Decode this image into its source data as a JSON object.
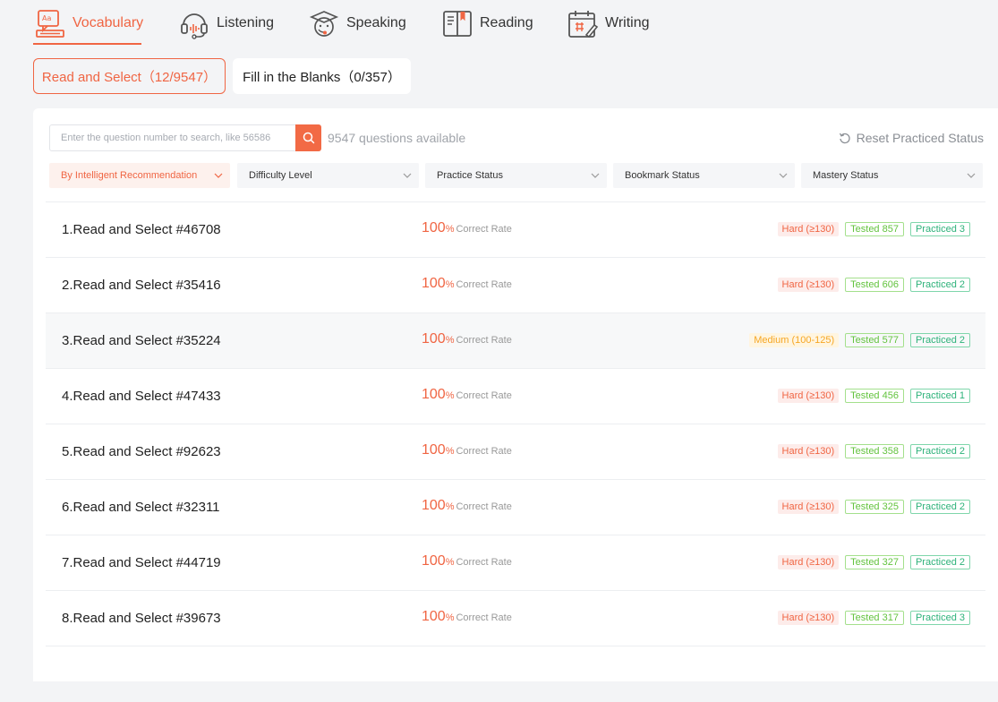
{
  "nav": [
    {
      "label": "Vocabulary",
      "icon": "vocabulary-icon",
      "active": true
    },
    {
      "label": "Listening",
      "icon": "headphones-icon",
      "active": false
    },
    {
      "label": "Speaking",
      "icon": "speaking-icon",
      "active": false
    },
    {
      "label": "Reading",
      "icon": "book-icon",
      "active": false
    },
    {
      "label": "Writing",
      "icon": "writing-icon",
      "active": false
    }
  ],
  "subtabs": [
    {
      "label": "Read and Select（12/9547）",
      "active": true
    },
    {
      "label": "Fill in the Blanks（0/357）",
      "active": false
    }
  ],
  "search": {
    "placeholder": "Enter the question number to search, like 56586",
    "value": ""
  },
  "available_text": "9547 questions available",
  "reset_label": "Reset Practiced Status",
  "filters": [
    {
      "label": "By Intelligent Recommendation",
      "active": true
    },
    {
      "label": "Difficulty Level",
      "active": false
    },
    {
      "label": "Practice Status",
      "active": false
    },
    {
      "label": "Bookmark Status",
      "active": false
    },
    {
      "label": "Mastery Status",
      "active": false
    }
  ],
  "rate_label": "Correct Rate",
  "questions": [
    {
      "title": "1.Read and Select #46708",
      "rate": "100",
      "difficulty": "Hard (≥130)",
      "level": "hard",
      "tested": "Tested 857",
      "practiced": "Practiced 3"
    },
    {
      "title": "2.Read and Select #35416",
      "rate": "100",
      "difficulty": "Hard (≥130)",
      "level": "hard",
      "tested": "Tested 606",
      "practiced": "Practiced 2"
    },
    {
      "title": "3.Read and Select #35224",
      "rate": "100",
      "difficulty": "Medium (100-125)",
      "level": "medium",
      "tested": "Tested 577",
      "practiced": "Practiced 2"
    },
    {
      "title": "4.Read and Select #47433",
      "rate": "100",
      "difficulty": "Hard (≥130)",
      "level": "hard",
      "tested": "Tested 456",
      "practiced": "Practiced 1"
    },
    {
      "title": "5.Read and Select #92623",
      "rate": "100",
      "difficulty": "Hard (≥130)",
      "level": "hard",
      "tested": "Tested 358",
      "practiced": "Practiced 2"
    },
    {
      "title": "6.Read and Select #32311",
      "rate": "100",
      "difficulty": "Hard (≥130)",
      "level": "hard",
      "tested": "Tested 325",
      "practiced": "Practiced 2"
    },
    {
      "title": "7.Read and Select #44719",
      "rate": "100",
      "difficulty": "Hard (≥130)",
      "level": "hard",
      "tested": "Tested 327",
      "practiced": "Practiced 2"
    },
    {
      "title": "8.Read and Select #39673",
      "rate": "100",
      "difficulty": "Hard (≥130)",
      "level": "hard",
      "tested": "Tested 317",
      "practiced": "Practiced 3"
    }
  ],
  "colors": {
    "accent": "#f06543",
    "tested": "#63c33e",
    "practiced": "#2db27a",
    "medium": "#f6a623"
  }
}
